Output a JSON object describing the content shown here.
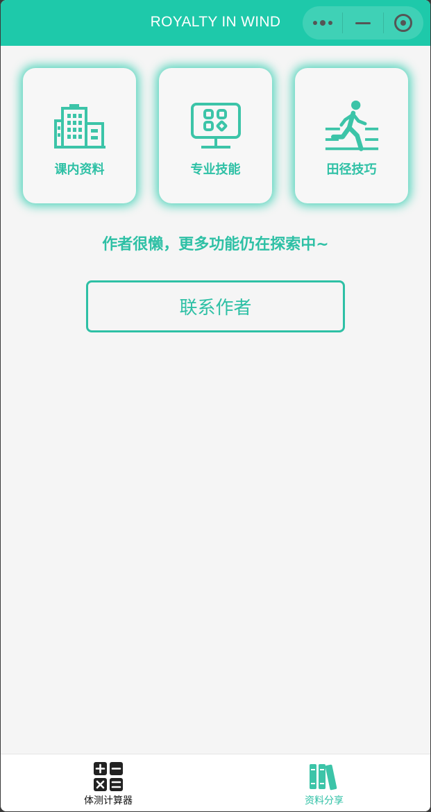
{
  "header": {
    "title": "ROYALTY IN WIND",
    "more_icon": "more-dots-icon",
    "minimize_icon": "minimize-icon",
    "close_icon": "target-close-icon"
  },
  "cards": [
    {
      "label": "课内资料",
      "icon": "building-icon"
    },
    {
      "label": "专业技能",
      "icon": "monitor-apps-icon"
    },
    {
      "label": "田径技巧",
      "icon": "running-person-icon"
    }
  ],
  "notice": "作者很懒，更多功能仍在探索中~",
  "contact_button": "联系作者",
  "tabbar": {
    "items": [
      {
        "label": "体测计算器",
        "icon": "calculator-icon",
        "active": false
      },
      {
        "label": "资料分享",
        "icon": "books-icon",
        "active": true
      }
    ]
  },
  "colors": {
    "accent": "#1ec9aa",
    "text_accent": "#2ec0a5",
    "background": "#f5f5f5"
  }
}
